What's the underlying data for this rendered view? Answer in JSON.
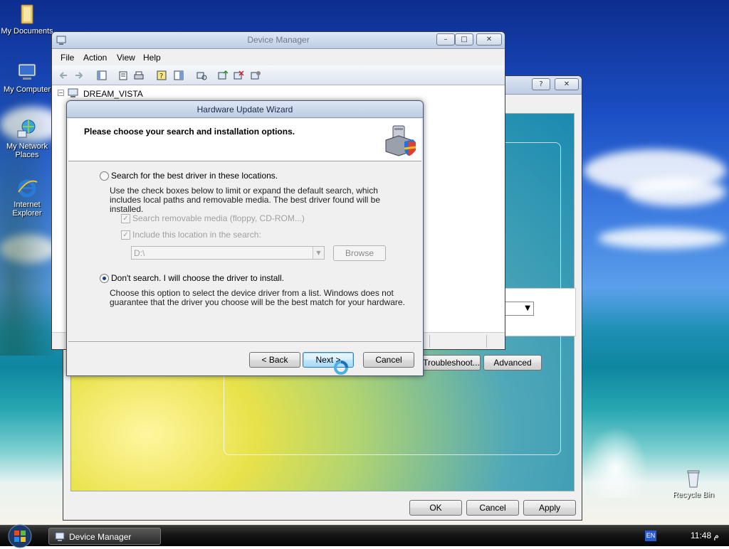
{
  "desktop": {
    "icons": [
      {
        "label": "My Documents",
        "icon": "folder-icon"
      },
      {
        "label": "My Computer",
        "icon": "computer-icon"
      },
      {
        "label": "My Network Places",
        "icon": "network-icon"
      },
      {
        "label": "Internet Explorer",
        "icon": "ie-icon"
      },
      {
        "label": "Recycle Bin",
        "icon": "recycle-bin-icon"
      }
    ]
  },
  "device_manager": {
    "title": "Device Manager",
    "menu": [
      "File",
      "Action",
      "View",
      "Help"
    ],
    "tree_root": "DREAM_VISTA",
    "tree_toggle": "−",
    "caption_min": "–",
    "caption_max": "□",
    "caption_close": "✕"
  },
  "properties": {
    "caption_help": "?",
    "caption_close": "✕",
    "troubleshoot_label": "Troubleshoot...",
    "advanced_label": "Advanced",
    "ok_label": "OK",
    "cancel_label": "Cancel",
    "apply_label": "Apply",
    "dropdown_arrow": "▼"
  },
  "wizard": {
    "title": "Hardware Update Wizard",
    "heading": "Please choose your search and installation options.",
    "option_search": "Search for the best driver in these locations.",
    "option_search_desc": "Use the check boxes below to limit or expand the default search, which includes local paths and removable media. The best driver found will be installed.",
    "check_removable": "Search removable media (floppy, CD-ROM...)",
    "check_include": "Include this location in the search:",
    "path_value": "D:\\",
    "browse_label": "Browse",
    "option_dont_search": "Don't search. I will choose the driver to install.",
    "option_dont_search_desc": "Choose this option to select the device driver from a list.  Windows does not guarantee that the driver you choose will be the best match for your hardware.",
    "back_label": "< Back",
    "next_label": "Next >",
    "cancel_label": "Cancel",
    "selected_option": "dont_search"
  },
  "taskbar": {
    "task_label": "Device Manager",
    "language": "EN",
    "clock": "11:48 م"
  }
}
